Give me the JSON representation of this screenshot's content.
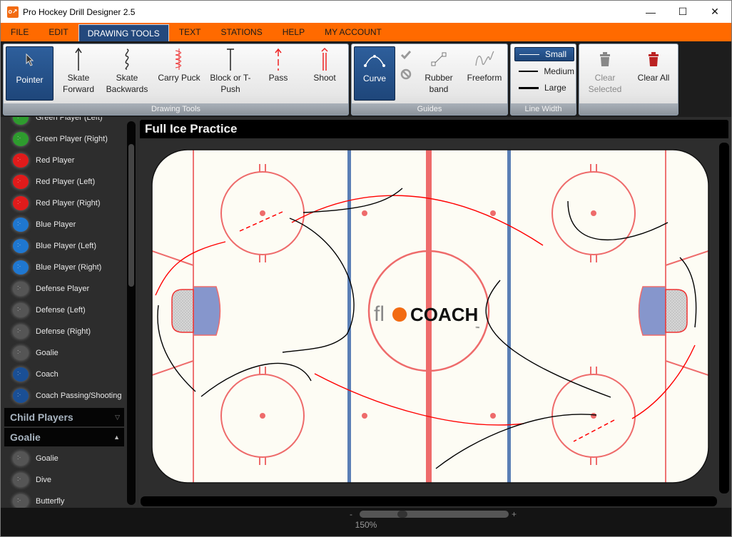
{
  "window": {
    "title": "Pro Hockey Drill Designer 2.5",
    "icon": "app-logo-icon",
    "controls": {
      "minimize": "—",
      "maximize": "☐",
      "close": "✕"
    }
  },
  "menu": [
    {
      "label": "FILE",
      "active": false
    },
    {
      "label": "EDIT",
      "active": false
    },
    {
      "label": "DRAWING TOOLS",
      "active": true
    },
    {
      "label": "TEXT",
      "active": false
    },
    {
      "label": "STATIONS",
      "active": false
    },
    {
      "label": "HELP",
      "active": false
    },
    {
      "label": "MY ACCOUNT",
      "active": false
    }
  ],
  "ribbon": {
    "drawing_tools": {
      "label": "Drawing Tools",
      "buttons": [
        {
          "label": "Pointer",
          "icon": "pointer-arrow-icon",
          "selected": true
        },
        {
          "label": "Skate Forward",
          "icon": "skate-forward-icon"
        },
        {
          "label": "Skate Backwards",
          "icon": "skate-backwards-icon"
        },
        {
          "label": "Carry Puck",
          "icon": "carry-puck-icon"
        },
        {
          "label": "Block or T-Push",
          "icon": "block-tpush-icon"
        },
        {
          "label": "Pass",
          "icon": "pass-icon"
        },
        {
          "label": "Shoot",
          "icon": "shoot-icon"
        }
      ]
    },
    "guides": {
      "label": "Guides",
      "buttons": [
        {
          "label": "Curve",
          "icon": "curve-icon",
          "selected": true
        },
        {
          "label": "Rubber band",
          "icon": "rubber-band-icon"
        },
        {
          "label": "Freeform",
          "icon": "freeform-icon"
        }
      ],
      "confirm_icon": "checkmark-icon",
      "cancel_icon": "cancel-circle-icon"
    },
    "line_width": {
      "label": "Line Width",
      "options": [
        {
          "label": "Small",
          "selected": true
        },
        {
          "label": "Medium",
          "selected": false
        },
        {
          "label": "Large",
          "selected": false
        }
      ]
    },
    "clear": {
      "clear_selected": {
        "label": "Clear Selected",
        "enabled": false
      },
      "clear_all": {
        "label": "Clear All",
        "enabled": true
      }
    }
  },
  "sidebar": {
    "items": [
      {
        "label": "Green Player (Left)",
        "color": "#2e9b2e"
      },
      {
        "label": "Green Player (Right)",
        "color": "#2e9b2e"
      },
      {
        "label": "Red Player",
        "color": "#e01b1b"
      },
      {
        "label": "Red Player (Left)",
        "color": "#e01b1b"
      },
      {
        "label": "Red Player (Right)",
        "color": "#e01b1b"
      },
      {
        "label": "Blue Player",
        "color": "#1f77d0"
      },
      {
        "label": "Blue Player (Left)",
        "color": "#1f77d0"
      },
      {
        "label": "Blue Player (Right)",
        "color": "#1f77d0"
      },
      {
        "label": "Defense Player",
        "color": "#555555"
      },
      {
        "label": "Defense (Left)",
        "color": "#555555"
      },
      {
        "label": "Defense (Right)",
        "color": "#555555"
      },
      {
        "label": "Goalie",
        "color": "#555555"
      },
      {
        "label": "Coach",
        "color": "#1a4f95"
      },
      {
        "label": "Coach Passing/Shooting",
        "color": "#1a4f95"
      }
    ],
    "sections": [
      {
        "label": "Child Players",
        "expanded": false
      },
      {
        "label": "Goalie",
        "expanded": true
      }
    ],
    "goalie_items": [
      {
        "label": "Goalie",
        "color": "#555555"
      },
      {
        "label": "Dive",
        "color": "#555555"
      },
      {
        "label": "Butterfly",
        "color": "#555555"
      }
    ]
  },
  "canvas": {
    "title": "Full Ice Practice",
    "logo": {
      "prefix": "fl",
      "brand": "COACH",
      "tm": "™"
    },
    "colors": {
      "ice": "#fdfcf4",
      "red_line": "#ee6b6b",
      "blue_line": "#5b7fb5",
      "crease": "#8696cc",
      "track_red": "#ff0000",
      "track_black": "#000000"
    }
  },
  "statusbar": {
    "zoom_minus": "-",
    "zoom_plus": "+",
    "zoom_level": "150%",
    "zoom_slider_fraction": 0.27
  }
}
